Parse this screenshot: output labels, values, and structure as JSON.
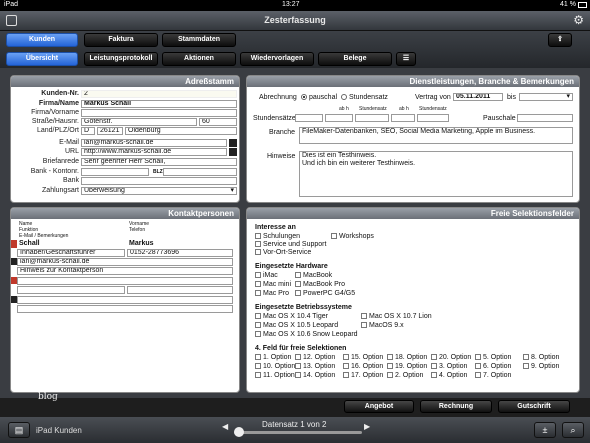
{
  "status": {
    "device": "iPad",
    "time": "13:27",
    "battery": "41 %"
  },
  "title": "Zesterfassung",
  "tabs_top": [
    "Kunden",
    "Faktura",
    "Stammdaten"
  ],
  "tabs_sub": [
    "Übersicht",
    "Leistungsprotokoll",
    "Aktionen",
    "Wiedervorlagen",
    "Belege"
  ],
  "adress": {
    "header": "Adreßstamm",
    "kunden_nr_label": "Kunden-Nr.",
    "kunden_nr": "2",
    "firma_label": "Firma/Name",
    "firma": "Markus Schall",
    "firma_vorname_label": "Firma/Vorname",
    "strasse_label": "Straße/Hausnr.",
    "strasse": "Gotenstr.",
    "hausnr": "60",
    "land_label": "Land/PLZ/Ort",
    "land": "D",
    "plz": "26121",
    "ort": "Oldenburg",
    "email_label": "E-Mail",
    "email": "ian@markus-schall.de",
    "url_label": "URL",
    "url": "http://www.markus-schall.de",
    "brief_label": "Briefanrede",
    "brief": "Sehr geehrter Herr Schall,",
    "bank_label": "Bank - Kontonr.",
    "blz_label": "BLZ",
    "bank2_label": "Bank",
    "zahl_label": "Zahlungsart",
    "zahl": "Überweisung"
  },
  "kontakt": {
    "header": "Kontaktpersonen",
    "col1": [
      "Name",
      "Funktion",
      "E-Mail / Bemerkungen"
    ],
    "col2": [
      "Vorname",
      "Telefon"
    ],
    "name": "Schall",
    "vorname": "Markus",
    "funktion": "Inhaber/Geschäftsführer",
    "telefon": "0152-28773696",
    "email": "ian@markus-schall.de",
    "hinweis": "Hinweis zur Kontaktperson"
  },
  "dienst": {
    "header": "Dienstleistungen, Branche & Bemerkungen",
    "abr_label": "Abrechnung",
    "pauschal": "pauschal",
    "stunden": "Stundensatz",
    "vertrag_label": "Vertrag von",
    "vertrag": "05.11.2011",
    "bis": "bis",
    "std_label": "Stundensätze",
    "ab_h": "ab h",
    "stundensatz": "Stundensatz",
    "pauschale_label": "Pauschale",
    "branche_label": "Branche",
    "branche": "FileMaker-Datenbanken, SEO, Social Media Marketing, Apple im Business.",
    "hinweise_label": "Hinweise",
    "hinweise1": "Dies ist ein Testhinweis.",
    "hinweise2": "Und ich bin ein weiterer Testhinweis."
  },
  "frei": {
    "header": "Freie Selektionsfelder",
    "interesse_title": "Interesse an",
    "interesse": [
      "Schulungen",
      "Service und Support",
      "Vor-Ort-Service"
    ],
    "workshops": "Workshops",
    "hardware_title": "Eingesetzte Hardware",
    "hardware_l": [
      "iMac",
      "Mac mini",
      "Mac Pro"
    ],
    "hardware_r": [
      "MacBook",
      "MacBook Pro",
      "PowerPC G4/G5"
    ],
    "os_title": "Eingesetzte Betriebssysteme",
    "os_l": [
      "Mac OS X 10.4 Tiger",
      "Mac OS X 10.5 Leopard",
      "Mac OS X 10.6 Snow Leopard"
    ],
    "os_r": [
      "Mac OS X 10.7 Lion",
      "MacOS 9.x"
    ],
    "feld_title": "4. Feld für freie Selektionen",
    "options": [
      [
        "1. Option",
        "15. Option",
        "20. Option",
        "8. Option"
      ],
      [
        "10. Option",
        "16. Option",
        "3. Option",
        "9. Option"
      ],
      [
        "11. Option",
        "17. Option",
        "4. Option",
        ""
      ]
    ],
    "options_b": [
      [
        "12. Option",
        "18. Option",
        "5. Option"
      ],
      [
        "13. Option",
        "19. Option",
        "6. Option"
      ],
      [
        "14. Option",
        "2. Option",
        "7. Option"
      ]
    ]
  },
  "blog": "blog",
  "bottom_buttons": [
    "Angebot",
    "Rechnung",
    "Gutschrift"
  ],
  "layout_name": "iPad Kunden",
  "record": "Datensatz 1 von 2"
}
